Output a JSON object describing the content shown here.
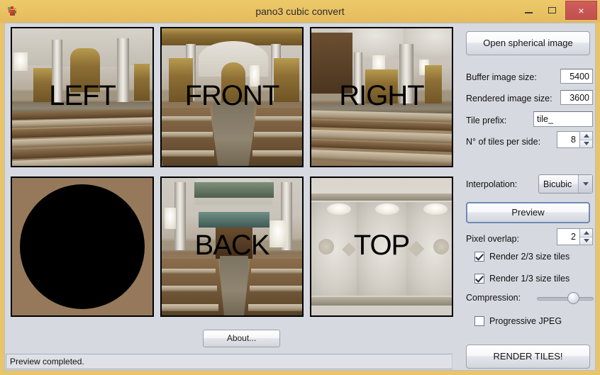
{
  "window": {
    "title": "pano3 cubic convert",
    "icon": "app-icon",
    "controls": {
      "minimize": "minimize-icon",
      "maximize": "maximize-icon",
      "close": "×"
    },
    "accent_titlebar": "#e9c264",
    "close_button_color": "#c14f4c"
  },
  "preview": {
    "faces": [
      {
        "id": "left",
        "label": "LEFT"
      },
      {
        "id": "front",
        "label": "FRONT"
      },
      {
        "id": "right",
        "label": "RIGHT"
      },
      {
        "id": "bottom",
        "label": ""
      },
      {
        "id": "back",
        "label": "BACK"
      },
      {
        "id": "top",
        "label": "TOP"
      }
    ]
  },
  "controls": {
    "open_spherical_label": "Open spherical image",
    "buffer_label": "Buffer image size:",
    "buffer_value": "5400",
    "rendered_label": "Rendered image size:",
    "rendered_value": "3600",
    "prefix_label": "Tile prefix:",
    "prefix_value": "tile_",
    "tiles_label": "N° of tiles per side:",
    "tiles_value": "8",
    "interpolation_label": "Interpolation:",
    "interpolation_value": "Bicubic",
    "preview_label": "Preview",
    "overlap_label": "Pixel overlap:",
    "overlap_value": "2",
    "render_23_label": "Render 2/3 size tiles",
    "render_23_checked": true,
    "render_13_label": "Render 1/3 size tiles",
    "render_13_checked": true,
    "compression_label": "Compression:",
    "compression_percent": 69,
    "progressive_label": "Progressive JPEG",
    "progressive_checked": false,
    "render_tiles_label": "RENDER TILES!"
  },
  "footer": {
    "about_label": "About...",
    "status_text": "Preview completed."
  }
}
